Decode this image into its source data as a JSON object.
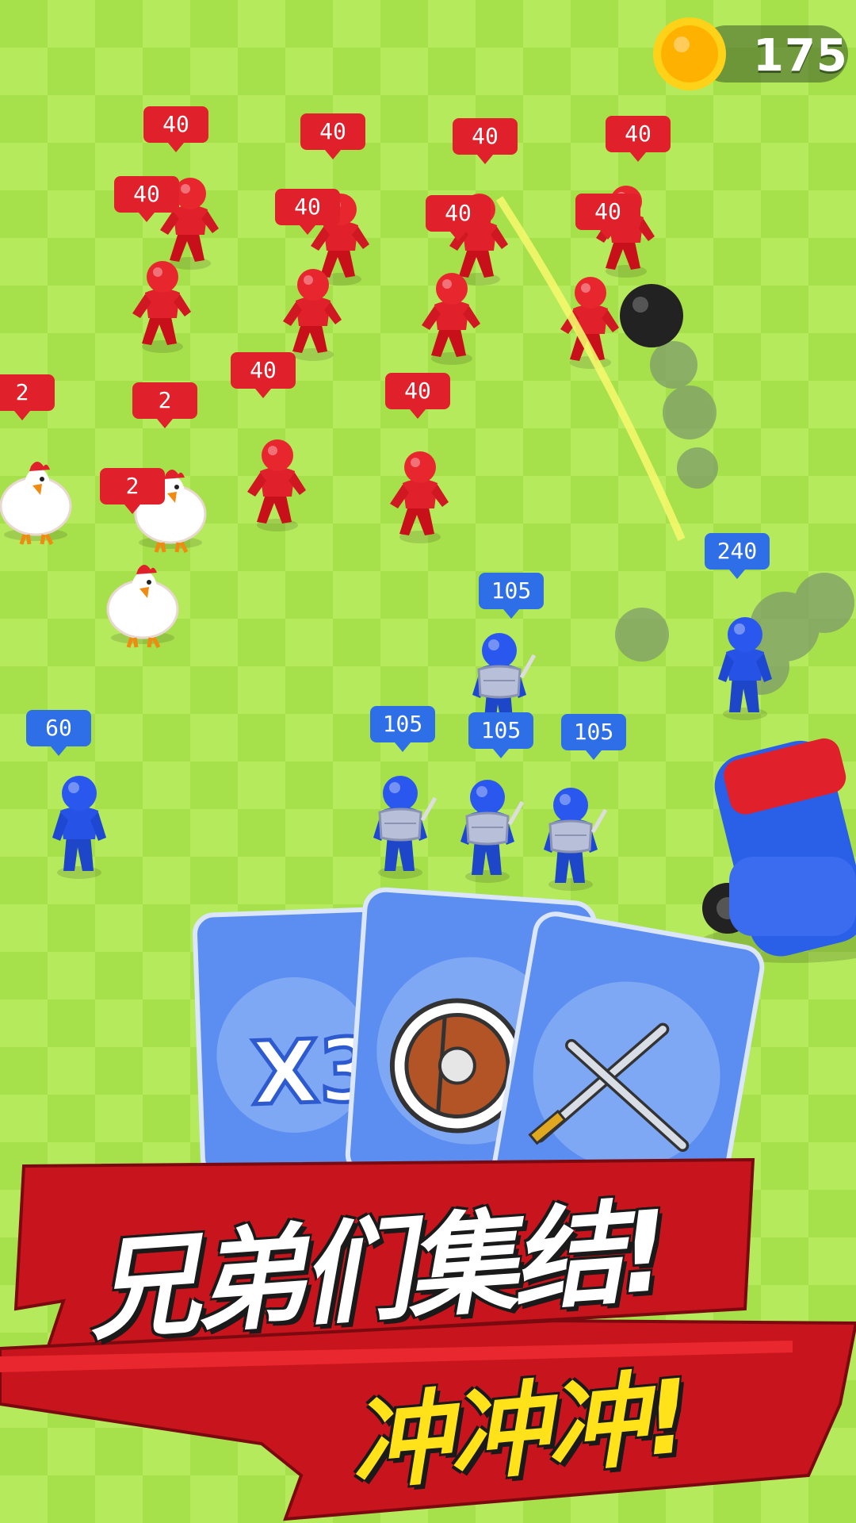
{
  "hud": {
    "coins": "175",
    "coin_icon": "gold-coin-icon"
  },
  "enemies": {
    "color": "#e0202a",
    "badges": [
      "40",
      "40",
      "40",
      "40",
      "40",
      "40",
      "40",
      "40",
      "40",
      "40"
    ],
    "chicken_badges": [
      "2",
      "2",
      "2"
    ]
  },
  "allies": {
    "color": "#2e6fe8",
    "badges": [
      "240",
      "105",
      "105",
      "105",
      "105",
      "60"
    ]
  },
  "cards": [
    {
      "icon": "multiplier-icon",
      "label": "X3"
    },
    {
      "icon": "shield-icon"
    },
    {
      "icon": "crossed-swords-icon"
    }
  ],
  "banner": {
    "line1": "兄弟们集结!",
    "line2": "冲冲冲!",
    "ribbon_color": "#c8141c",
    "line2_color": "#ffe21a"
  }
}
